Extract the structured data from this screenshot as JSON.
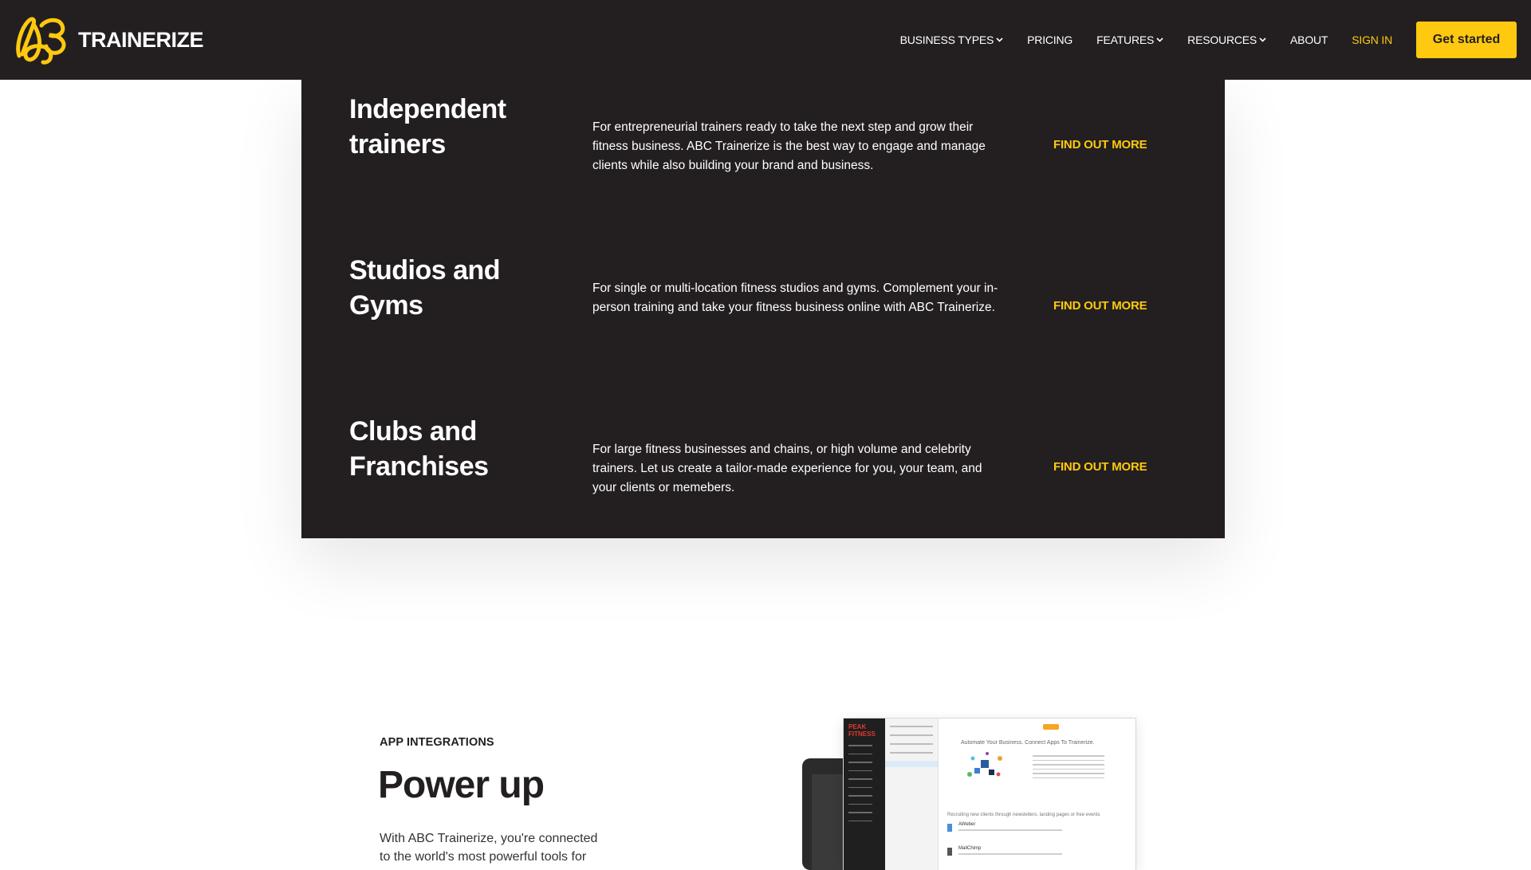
{
  "header": {
    "logo_text": "TRAINERIZE",
    "nav": [
      {
        "label": "BUSINESS TYPES",
        "dropdown": true
      },
      {
        "label": "PRICING",
        "dropdown": false
      },
      {
        "label": "FEATURES",
        "dropdown": true
      },
      {
        "label": "RESOURCES",
        "dropdown": true
      },
      {
        "label": "ABOUT",
        "dropdown": false
      },
      {
        "label": "SIGN IN",
        "dropdown": false
      }
    ],
    "cta_label": "Get started"
  },
  "business_types": [
    {
      "title": "Independent trainers",
      "description": "For entrepreneurial trainers ready to take the next step and grow their fitness business. ABC Trainerize is the best way to engage and manage clients while also building your brand and business.",
      "link": "FIND OUT MORE"
    },
    {
      "title": "Studios and Gyms",
      "description": "For single or multi-location fitness studios and gyms. Complement your in-person training and take your fitness business online with ABC Trainerize.",
      "link": "FIND OUT MORE"
    },
    {
      "title": "Clubs and Franchises",
      "description": "For large fitness businesses and chains, or high volume and celebrity trainers. Let us create a tailor-made experience for you, your team, and your clients or memebers.",
      "link": "FIND OUT MORE"
    }
  ],
  "integrations": {
    "eyebrow": "APP INTEGRATIONS",
    "heading": "Power up",
    "body": "With ABC Trainerize, you're connected to the world's most powerful tools for",
    "mockup": {
      "brand": "PEAK FITNESS",
      "heading": "Automate Your Business. Connect Apps To Trainerize.",
      "subheading": "Recruiting new clients through newsletters, landing pages or free events",
      "items": [
        "AWeber",
        "MailChimp"
      ]
    }
  },
  "colors": {
    "dark": "#231f20",
    "accent": "#fec90f",
    "white": "#ffffff"
  }
}
